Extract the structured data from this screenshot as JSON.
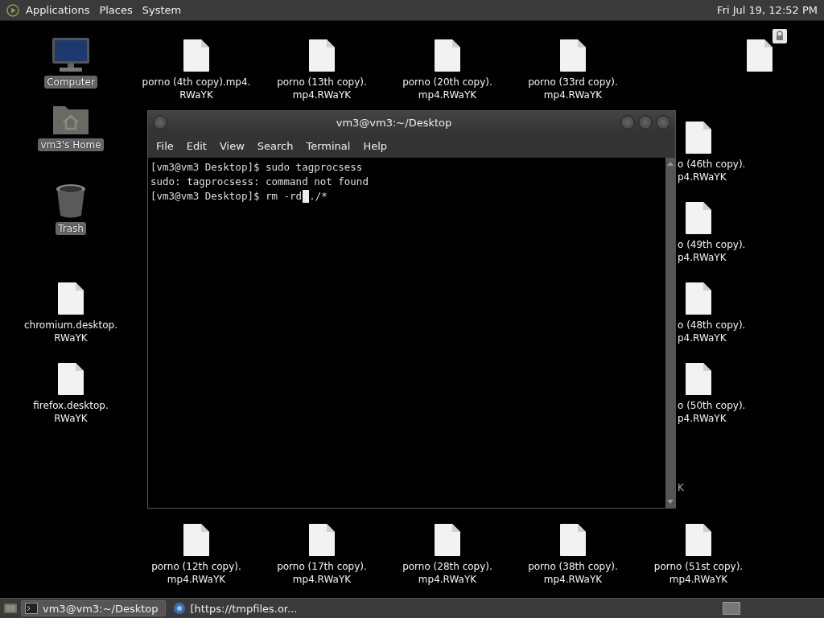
{
  "top_panel": {
    "menus": [
      "Applications",
      "Places",
      "System"
    ],
    "clock": "Fri Jul 19, 12:52 PM"
  },
  "desktop_icons": [
    {
      "kind": "computer",
      "label": [
        "Computer"
      ]
    },
    {
      "kind": "home",
      "label": [
        "vm3's Home"
      ]
    },
    {
      "kind": "trash",
      "label": [
        "Trash"
      ]
    },
    {
      "kind": "file",
      "label": [
        "chromium.desktop.",
        "RWaYK"
      ]
    },
    {
      "kind": "file",
      "label": [
        "firefox.desktop.",
        "RWaYK"
      ]
    },
    {
      "kind": "file",
      "label": [
        "porno (4th copy).mp4.",
        "RWaYK"
      ]
    },
    {
      "kind": "file",
      "label": [
        "porno (13th copy).",
        "mp4.RWaYK"
      ]
    },
    {
      "kind": "file",
      "label": [
        "porno (20th copy).",
        "mp4.RWaYK"
      ]
    },
    {
      "kind": "file",
      "label": [
        "porno (33rd copy).",
        "mp4.RWaYK"
      ]
    },
    {
      "kind": "locked_file"
    },
    {
      "kind": "partial",
      "label": [
        "o (46th copy).",
        "p4.RWaYK"
      ]
    },
    {
      "kind": "partial",
      "label": [
        "o (49th copy).",
        "p4.RWaYK"
      ]
    },
    {
      "kind": "partial",
      "label": [
        "o (48th copy).",
        "p4.RWaYK"
      ]
    },
    {
      "kind": "partial",
      "label": [
        "o (50th copy).",
        "p4.RWaYK"
      ]
    },
    {
      "kind": "label_only",
      "label": [
        "K"
      ]
    },
    {
      "kind": "file",
      "label": [
        "porno (12th copy).",
        "mp4.RWaYK"
      ]
    },
    {
      "kind": "file",
      "label": [
        "porno (17th copy).",
        "mp4.RWaYK"
      ]
    },
    {
      "kind": "file",
      "label": [
        "porno (28th copy).",
        "mp4.RWaYK"
      ]
    },
    {
      "kind": "file",
      "label": [
        "porno (38th copy).",
        "mp4.RWaYK"
      ]
    },
    {
      "kind": "file",
      "label": [
        "porno (51st copy).",
        "mp4.RWaYK"
      ]
    }
  ],
  "terminal": {
    "title": "vm3@vm3:~/Desktop",
    "menus": [
      "File",
      "Edit",
      "View",
      "Search",
      "Terminal",
      "Help"
    ],
    "lines": [
      {
        "text": "[vm3@vm3 Desktop]$ sudo tagprocsess"
      },
      {
        "text": "sudo: tagprocsess: command not found"
      },
      {
        "text": "[vm3@vm3 Desktop]$ rm -rd",
        "cursor": true,
        "after": "./*"
      }
    ]
  },
  "taskbar": {
    "tasks": [
      {
        "kind": "terminal",
        "label": "vm3@vm3:~/Desktop",
        "selected": true
      },
      {
        "kind": "browser",
        "label": "[https://tmpfiles.or...",
        "selected": false
      }
    ]
  }
}
